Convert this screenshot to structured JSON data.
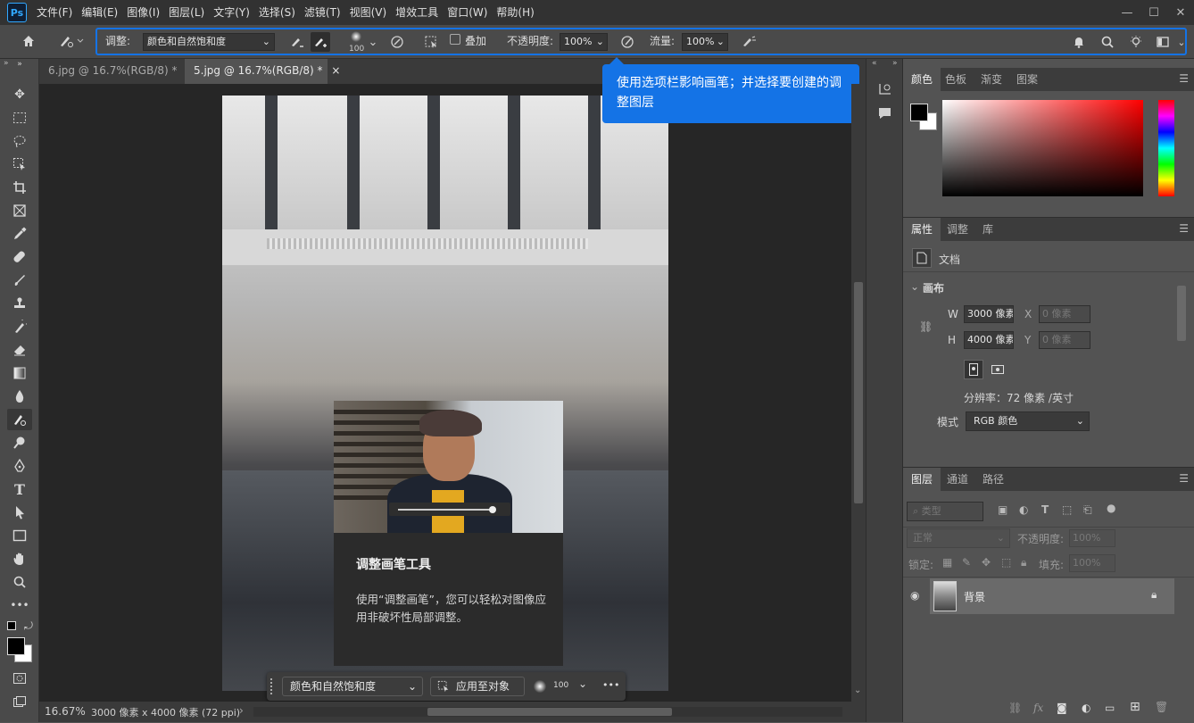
{
  "menubar": {
    "logo": "Ps",
    "items": [
      "文件(F)",
      "编辑(E)",
      "图像(I)",
      "图层(L)",
      "文字(Y)",
      "选择(S)",
      "滤镜(T)",
      "视图(V)",
      "增效工具",
      "窗口(W)",
      "帮助(H)"
    ],
    "min": "—",
    "max": "☐",
    "close": "✕"
  },
  "options": {
    "adjust_label": "调整:",
    "adjust_value": "颜色和自然饱和度",
    "brush_size": "100",
    "overlay_label": "叠加",
    "opacity_label": "不透明度:",
    "opacity_value": "100%",
    "flow_label": "流量:",
    "flow_value": "100%"
  },
  "tabs": [
    {
      "label": "6.jpg @ 16.7%(RGB/8) *",
      "close": "×"
    },
    {
      "label": "5.jpg @ 16.7%(RGB/8) *",
      "close": "×"
    }
  ],
  "callout": {
    "text": "使用选项栏影响画笔；并选择要创建的调整图层"
  },
  "tip": {
    "title": "调整画笔工具",
    "body": "使用“调整画笔”，您可以轻松对图像应用非破坏性局部调整。"
  },
  "context_bar": {
    "adjust_value": "颜色和自然饱和度",
    "apply_label": "应用至对象",
    "brush_size": "100",
    "more": "•••"
  },
  "status": {
    "zoom": "16.67%",
    "info": "3000 像素 x 4000 像素 (72 ppi)",
    "arrow": "›"
  },
  "color_panel": {
    "tabs": [
      "颜色",
      "色板",
      "渐变",
      "图案"
    ]
  },
  "properties_panel": {
    "tabs": [
      "属性",
      "调整",
      "库"
    ],
    "doc_label": "文档",
    "section": "画布",
    "w_label": "W",
    "w_value": "3000 像素",
    "h_label": "H",
    "h_value": "4000 像素",
    "x_label": "X",
    "x_value": "0 像素",
    "y_label": "Y",
    "y_value": "0 像素",
    "resolution": "分辨率：72 像素 /英寸",
    "mode_label": "模式",
    "mode_value": "RGB 颜色"
  },
  "layers_panel": {
    "tabs": [
      "图层",
      "通道",
      "路径"
    ],
    "filter_placeholder": "类型",
    "blend_mode": "正常",
    "opacity_label": "不透明度:",
    "opacity_value": "100%",
    "lock_label": "锁定:",
    "fill_label": "填充:",
    "fill_value": "100%",
    "layer_name": "背景",
    "footer_fx": "fx"
  },
  "colors": {
    "accent": "#1473e6",
    "menubar": "#323232",
    "panel": "#535353"
  }
}
